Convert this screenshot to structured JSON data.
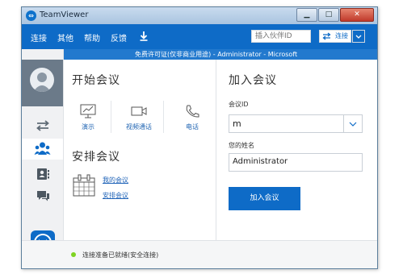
{
  "window": {
    "title": "TeamViewer",
    "logo_glyph": "⇔"
  },
  "menu": {
    "items": [
      "连接",
      "其他",
      "帮助",
      "反馈"
    ],
    "partner_id_placeholder": "插入伙伴ID",
    "connect_label": "连接"
  },
  "license_text": "免费许可证(仅非商业用途) - Administrator - Microsoft",
  "start_meeting": {
    "title": "开始会议",
    "features": [
      {
        "label": "演示",
        "icon": "presentation-icon"
      },
      {
        "label": "视频通话",
        "icon": "video-camera-icon"
      },
      {
        "label": "电话",
        "icon": "phone-icon"
      }
    ]
  },
  "schedule_meeting": {
    "title": "安排会议",
    "links": [
      "我的会议",
      "安排会议"
    ]
  },
  "join_meeting": {
    "title": "加入会议",
    "id_label": "会议ID",
    "id_value": "m",
    "name_label": "您的姓名",
    "name_value": "Administrator",
    "join_button": "加入会议"
  },
  "status": {
    "text": "连接准备已就绪(安全连接)",
    "color": "#7ed321"
  },
  "colors": {
    "brand": "#0e6bc7",
    "accent_link": "#1f63b8"
  }
}
